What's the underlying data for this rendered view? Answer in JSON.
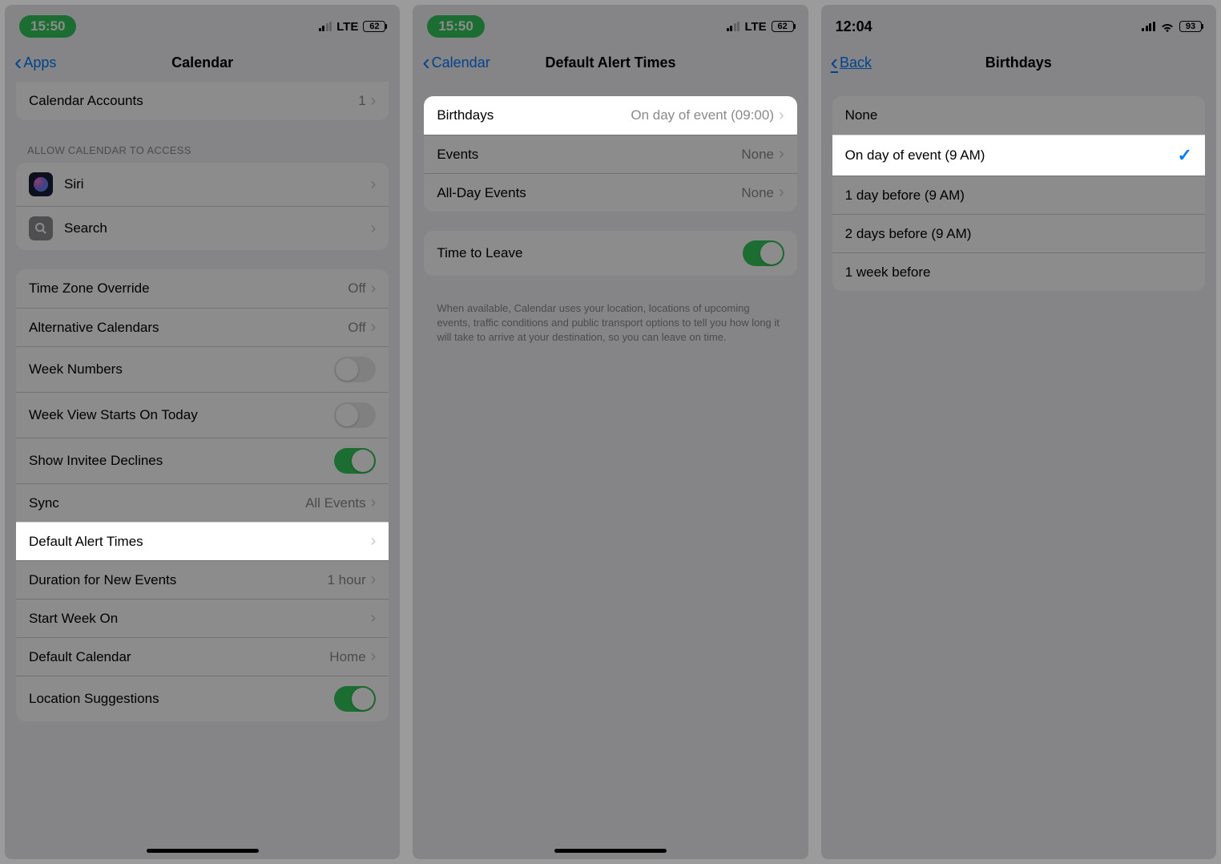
{
  "screen1": {
    "status": {
      "time": "15:50",
      "network": "LTE",
      "battery": "62"
    },
    "nav": {
      "back": "Apps",
      "title": "Calendar"
    },
    "row_accounts": {
      "label": "Calendar Accounts",
      "value": "1"
    },
    "section_access_header": "ALLOW CALENDAR TO ACCESS",
    "row_siri": "Siri",
    "row_search": "Search",
    "row_tz": {
      "label": "Time Zone Override",
      "value": "Off"
    },
    "row_altcal": {
      "label": "Alternative Calendars",
      "value": "Off"
    },
    "row_weeknum": "Week Numbers",
    "row_weekstart": "Week View Starts On Today",
    "row_invitee": "Show Invitee Declines",
    "row_sync": {
      "label": "Sync",
      "value": "All Events"
    },
    "row_alerts": "Default Alert Times",
    "row_duration": {
      "label": "Duration for New Events",
      "value": "1 hour"
    },
    "row_startweek": "Start Week On",
    "row_defcal": {
      "label": "Default Calendar",
      "value": "Home"
    },
    "row_locsug": "Location Suggestions"
  },
  "screen2": {
    "status": {
      "time": "15:50",
      "network": "LTE",
      "battery": "62"
    },
    "nav": {
      "back": "Calendar",
      "title": "Default Alert Times"
    },
    "row_birthdays": {
      "label": "Birthdays",
      "value": "On day of event (09:00)"
    },
    "row_events": {
      "label": "Events",
      "value": "None"
    },
    "row_allday": {
      "label": "All-Day Events",
      "value": "None"
    },
    "row_ttl": "Time to Leave",
    "ttl_footer": "When available, Calendar uses your location, locations of upcoming events, traffic conditions and public transport options to tell you how long it will take to arrive at your destination, so you can leave on time."
  },
  "screen3": {
    "status": {
      "time": "12:04",
      "battery": "93"
    },
    "nav": {
      "back": "Back",
      "title": "Birthdays"
    },
    "opt_none": "None",
    "opt_onday": "On day of event (9 AM)",
    "opt_1day": "1 day before (9 AM)",
    "opt_2day": "2 days before (9 AM)",
    "opt_1week": "1 week before"
  }
}
